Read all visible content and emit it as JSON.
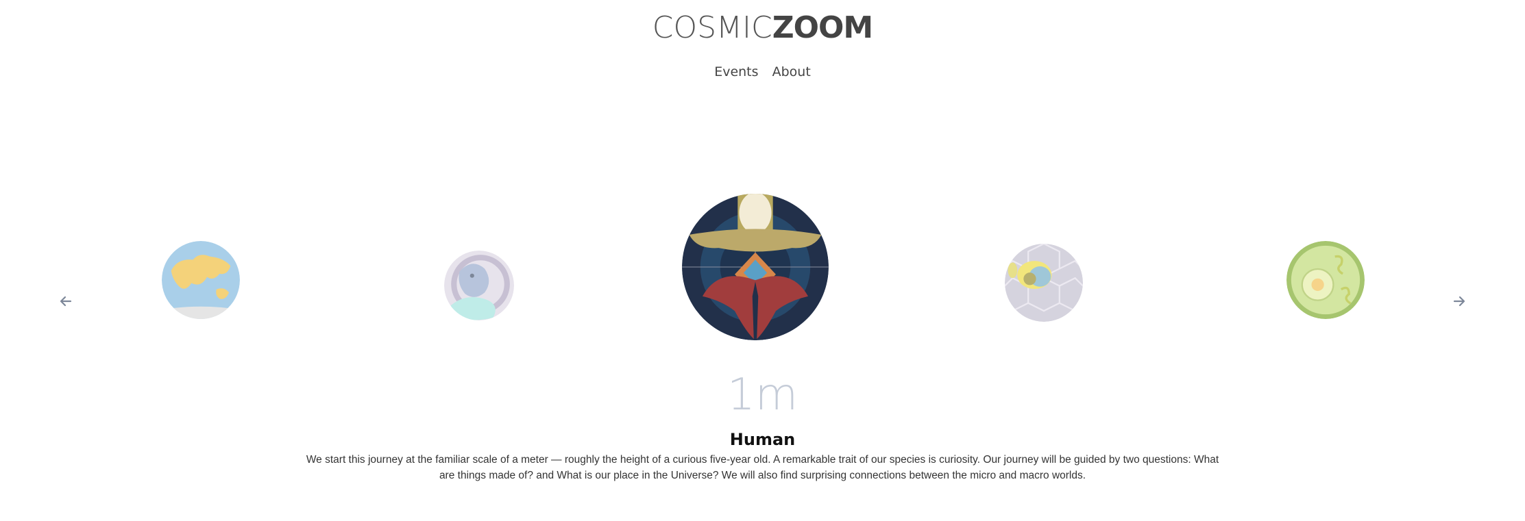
{
  "logo": {
    "part1": "COSMIC",
    "part2": "ZOOM"
  },
  "nav": {
    "items": [
      {
        "label": "Events"
      },
      {
        "label": "About"
      }
    ]
  },
  "carousel": {
    "prev_icon": "arrow-left-icon",
    "next_icon": "arrow-right-icon",
    "thumbnails": [
      {
        "name": "earth-thumbnail"
      },
      {
        "name": "whale-thumbnail"
      },
      {
        "name": "human-thumbnail"
      },
      {
        "name": "cell-cluster-thumbnail"
      },
      {
        "name": "cell-thumbnail"
      }
    ]
  },
  "current": {
    "scale": "1m",
    "title": "Human",
    "description": "We start this journey at the familiar scale of a meter — roughly the height of a curious five-year old. A remarkable trait of our species is curiosity. Our journey will be guided by two questions: What are things made of? and What is our place in the Universe? We will also find surprising connections between the micro and macro worlds."
  },
  "colors": {
    "scale_text": "#c5ccd8",
    "arrow": "#7d8799"
  }
}
